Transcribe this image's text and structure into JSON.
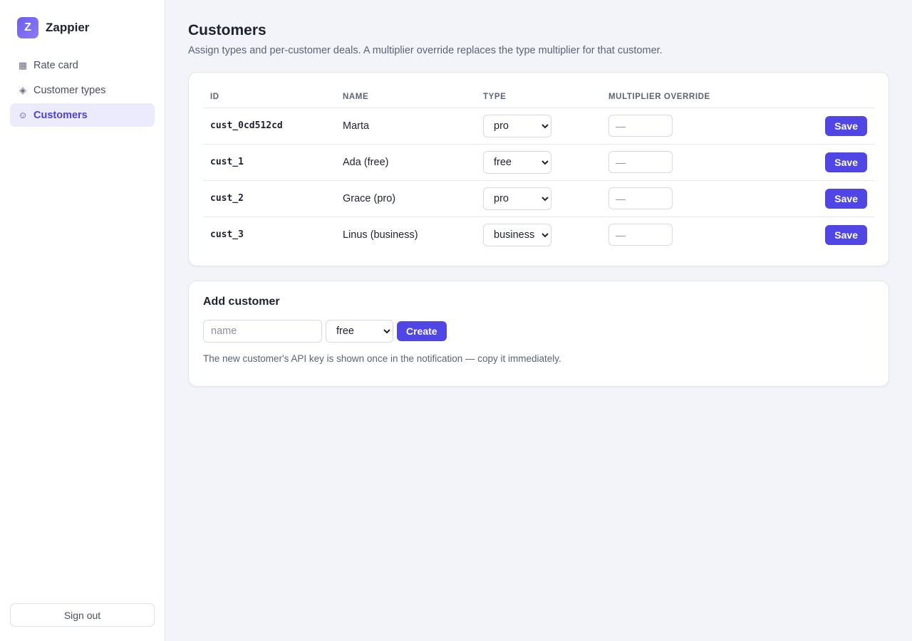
{
  "brand": {
    "logo_letter": "Z",
    "name": "Zappier",
    "accent": "#4f46e5"
  },
  "sidebar": {
    "items": [
      {
        "label": "Rate card",
        "icon": "grid-icon",
        "glyph": "▦",
        "active": false
      },
      {
        "label": "Customer types",
        "icon": "diamond-icon",
        "glyph": "◈",
        "active": false
      },
      {
        "label": "Customers",
        "icon": "smiley-icon",
        "glyph": "☺",
        "active": true
      }
    ],
    "signout_label": "Sign out"
  },
  "page": {
    "title": "Customers",
    "subtitle": "Assign types and per-customer deals. A multiplier override replaces the type multiplier for that customer."
  },
  "table": {
    "headers": {
      "id": "ID",
      "name": "NAME",
      "type": "TYPE",
      "multiplier": "MULTIPLIER OVERRIDE"
    },
    "rows": [
      {
        "id": "cust_0cd512cd",
        "name": "Marta",
        "type": "pro",
        "multiplier_placeholder": "—",
        "save_label": "Save"
      },
      {
        "id": "cust_1",
        "name": "Ada (free)",
        "type": "free",
        "multiplier_placeholder": "—",
        "save_label": "Save"
      },
      {
        "id": "cust_2",
        "name": "Grace (pro)",
        "type": "pro",
        "multiplier_placeholder": "—",
        "save_label": "Save"
      },
      {
        "id": "cust_3",
        "name": "Linus (business)",
        "type": "business",
        "multiplier_placeholder": "—",
        "save_label": "Save"
      }
    ]
  },
  "add_customer": {
    "title": "Add customer",
    "name_placeholder": "name",
    "type": "free",
    "create_label": "Create",
    "note": "The new customer's API key is shown once in the notification — copy it immediately."
  }
}
